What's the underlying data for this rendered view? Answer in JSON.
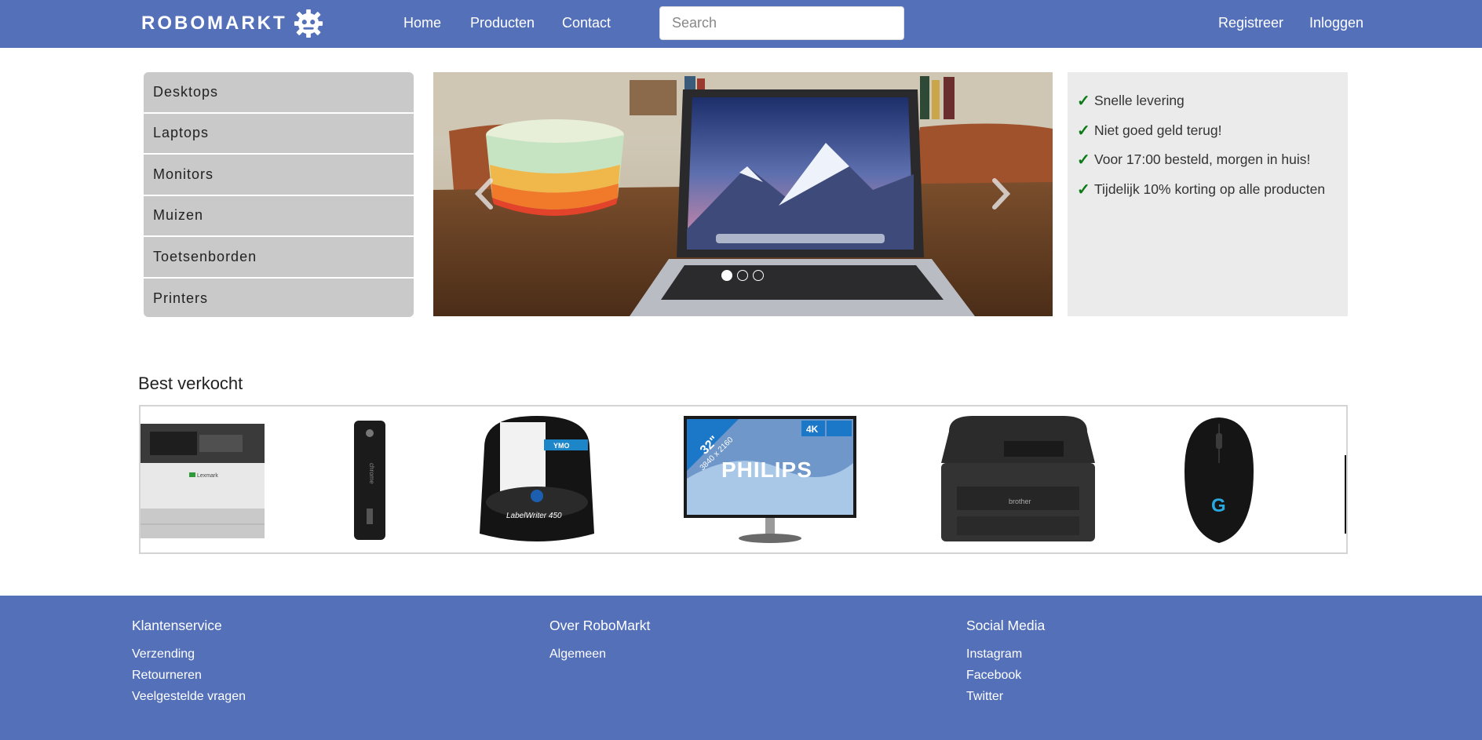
{
  "header": {
    "logo_text": "ROBOMARKT",
    "nav": [
      "Home",
      "Producten",
      "Contact"
    ],
    "search_placeholder": "Search",
    "auth": [
      "Registreer",
      "Inloggen"
    ],
    "brand_color": "#5470b9"
  },
  "sidebar": {
    "items": [
      "Desktops",
      "Laptops",
      "Monitors",
      "Muizen",
      "Toetsenborden",
      "Printers"
    ]
  },
  "carousel": {
    "slide_count": 3,
    "active_slide": 1,
    "icons": [
      "chevron-left-icon",
      "chevron-right-icon"
    ]
  },
  "usp": {
    "items": [
      "Snelle levering",
      "Niet goed geld terug!",
      "Voor 17:00 besteld, morgen in huis!",
      "Tijdelijk 10% korting op alle producten"
    ],
    "check_color": "#0a7a14"
  },
  "best_sold": {
    "title": "Best verkocht",
    "products": [
      {
        "name": "printer-lexmark",
        "brand": "Lexmark"
      },
      {
        "name": "asus-chromebit",
        "brand": "chrome"
      },
      {
        "name": "dymo-labelwriter",
        "brand": "LabelWriter 450"
      },
      {
        "name": "philips-monitor",
        "brand": "PHILIPS",
        "size": "32\"",
        "resolution": "3840 x 2160",
        "badge": "4K"
      },
      {
        "name": "brother-printer",
        "brand": "brother"
      },
      {
        "name": "logitech-mouse",
        "brand": "G"
      }
    ]
  },
  "footer": {
    "columns": [
      {
        "title": "Klantenservice",
        "links": [
          "Verzending",
          "Retourneren",
          "Veelgestelde vragen"
        ]
      },
      {
        "title": "Over RoboMarkt",
        "links": [
          "Algemeen"
        ]
      },
      {
        "title": "Social Media",
        "links": [
          "Instagram",
          "Facebook",
          "Twitter"
        ]
      }
    ]
  }
}
